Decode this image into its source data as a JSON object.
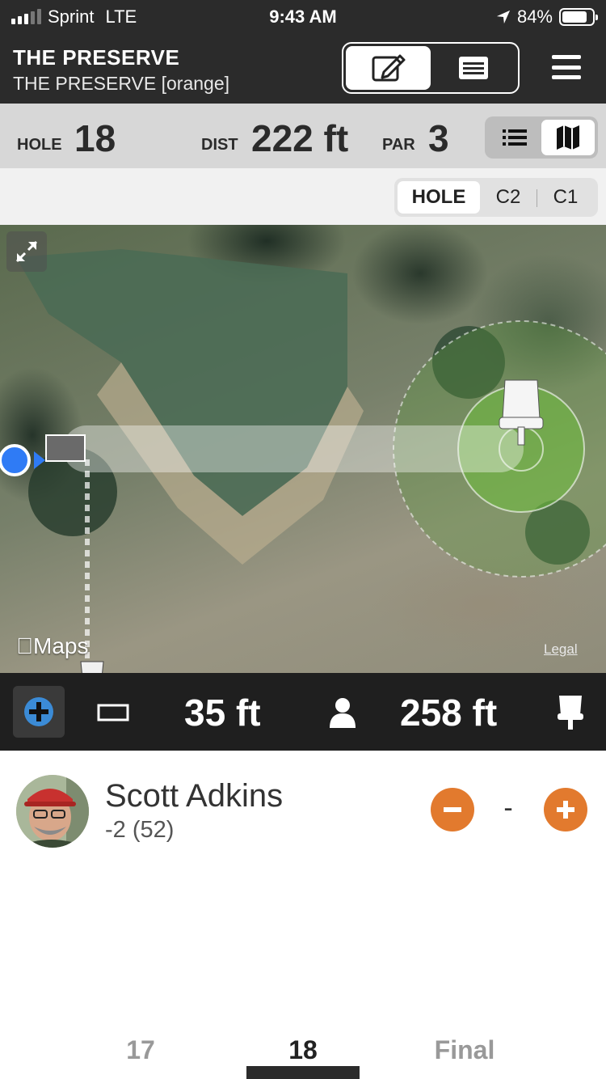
{
  "status_bar": {
    "carrier": "Sprint",
    "network": "LTE",
    "time": "9:43 AM",
    "battery": "84%",
    "battery_level": 0.84
  },
  "header": {
    "title": "THE PRESERVE",
    "subtitle": "THE PRESERVE [orange]",
    "edit_icon": "edit-icon",
    "scorecard_icon": "scorecard-icon",
    "menu_icon": "menu-icon"
  },
  "hole_info": {
    "hole_label": "HOLE",
    "hole_value": "18",
    "dist_label": "DIST",
    "dist_value": "222 ft",
    "par_label": "PAR",
    "par_value": "3"
  },
  "view_toggle": [
    "list-view-icon",
    "map-view-icon"
  ],
  "map_modes": {
    "items": [
      "HOLE",
      "C2",
      "C1"
    ],
    "selected": "HOLE"
  },
  "map": {
    "attribution": "Maps",
    "legal": "Legal"
  },
  "distances": {
    "shot_distance": "35 ft",
    "remaining_distance": "258 ft"
  },
  "player": {
    "name": "Scott Adkins",
    "score": "-2 (52)",
    "hole_score": "-"
  },
  "colors": {
    "accent": "#e27a2e",
    "header_bg": "#2b2b2b",
    "location_blue": "#2f7bf5"
  },
  "tabs": {
    "items": [
      "17",
      "18",
      "Final"
    ],
    "active": "18"
  }
}
